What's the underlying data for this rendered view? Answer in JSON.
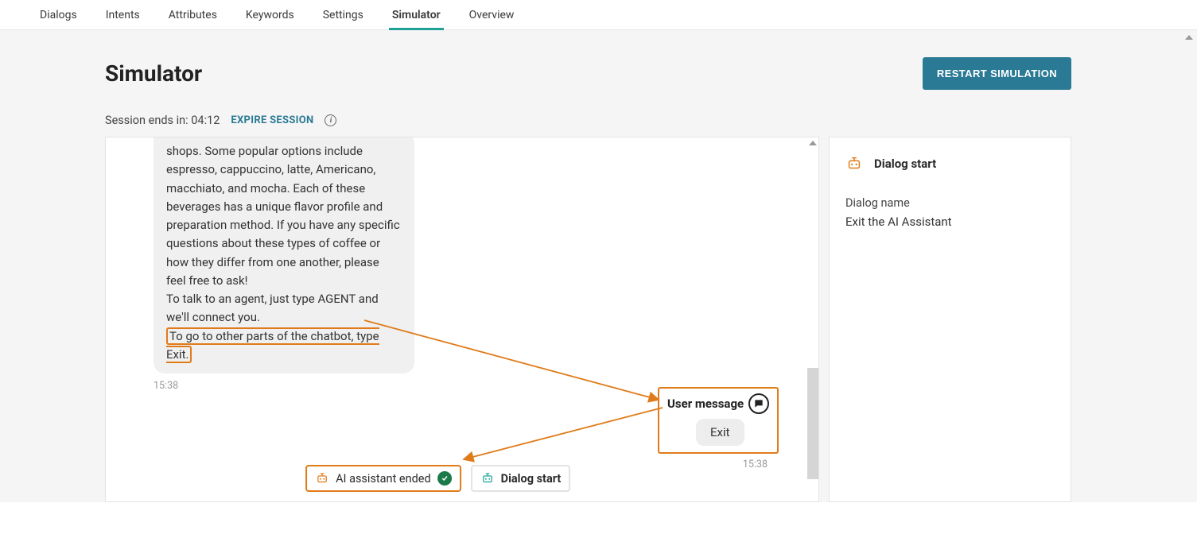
{
  "tabs": [
    "Dialogs",
    "Intents",
    "Attributes",
    "Keywords",
    "Settings",
    "Simulator",
    "Overview"
  ],
  "active_tab_index": 5,
  "page": {
    "title": "Simulator",
    "restart_label": "RESTART SIMULATION",
    "session_prefix": "Session ends in: ",
    "session_time": "04:12",
    "expire_label": "EXPIRE SESSION"
  },
  "chat": {
    "bot_message_main": "shops. Some popular options include espresso, cappuccino, latte, Americano, macchiato, and mocha. Each of these beverages has a unique flavor profile and preparation method. If you have any specific questions about these types of coffee or how they differ from one another, please feel free to ask!\nTo talk to an agent, just type AGENT and we'll connect you.",
    "bot_message_highlight": "To go to other parts of the chatbot, type Exit.",
    "bot_time": "15:38",
    "user_label": "User message",
    "user_text": "Exit",
    "user_time": "15:38",
    "status_ended": "AI assistant ended",
    "status_dialog": "Dialog start"
  },
  "side": {
    "header": "Dialog start",
    "dialog_name_label": "Dialog name",
    "dialog_name_value": "Exit the AI Assistant"
  }
}
